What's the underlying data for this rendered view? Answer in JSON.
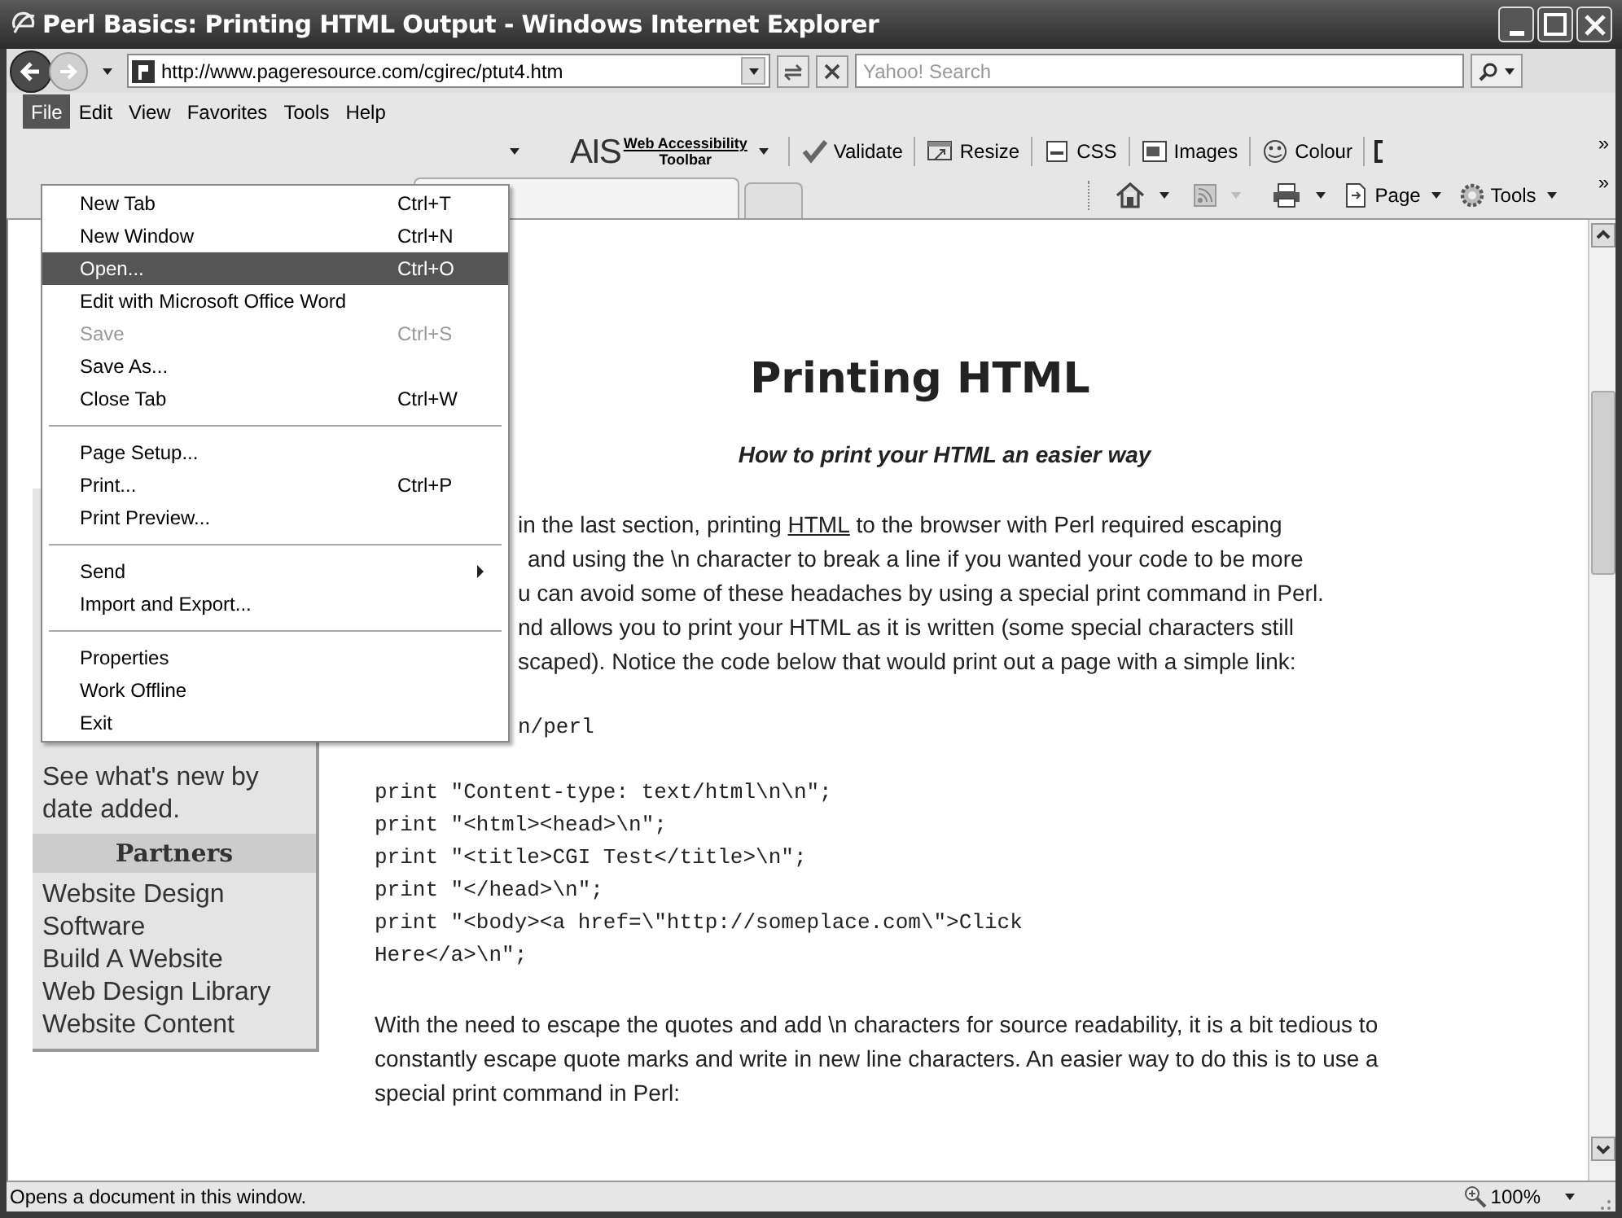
{
  "window": {
    "title": "Perl Basics: Printing HTML Output - Windows Internet Explorer"
  },
  "address_bar": {
    "url": "http://www.pageresource.com/cgirec/ptut4.htm"
  },
  "search": {
    "placeholder": "Yahoo! Search"
  },
  "menu_bar": [
    {
      "label": "File",
      "selected": true
    },
    {
      "label": "Edit",
      "selected": false
    },
    {
      "label": "View",
      "selected": false
    },
    {
      "label": "Favorites",
      "selected": false
    },
    {
      "label": "Tools",
      "selected": false
    },
    {
      "label": "Help",
      "selected": false
    }
  ],
  "toolbar": {
    "ais_logo": "AIS",
    "ais_title": "Web Accessibility",
    "ais_subtitle": "Toolbar",
    "buttons": [
      {
        "label": "Validate"
      },
      {
        "label": "Resize"
      },
      {
        "label": "CSS"
      },
      {
        "label": "Images"
      },
      {
        "label": "Colour"
      }
    ],
    "more": "»"
  },
  "command_bar": {
    "buttons": [
      {
        "label": "Page"
      },
      {
        "label": "Tools"
      }
    ],
    "more": "»"
  },
  "file_menu": [
    {
      "kind": "item",
      "label": "New Tab",
      "shortcut": "Ctrl+T",
      "selected": false,
      "disabled": false
    },
    {
      "kind": "item",
      "label": "New Window",
      "shortcut": "Ctrl+N",
      "selected": false,
      "disabled": false
    },
    {
      "kind": "item",
      "label": "Open...",
      "shortcut": "Ctrl+O",
      "selected": true,
      "disabled": false
    },
    {
      "kind": "item",
      "label": "Edit with Microsoft Office Word",
      "selected": false,
      "disabled": false
    },
    {
      "kind": "item",
      "label": "Save",
      "shortcut": "Ctrl+S",
      "selected": false,
      "disabled": true
    },
    {
      "kind": "item",
      "label": "Save As...",
      "selected": false,
      "disabled": false
    },
    {
      "kind": "item",
      "label": "Close Tab",
      "shortcut": "Ctrl+W",
      "selected": false,
      "disabled": false
    },
    {
      "kind": "separator"
    },
    {
      "kind": "item",
      "label": "Page Setup...",
      "selected": false,
      "disabled": false
    },
    {
      "kind": "item",
      "label": "Print...",
      "shortcut": "Ctrl+P",
      "selected": false,
      "disabled": false
    },
    {
      "kind": "item",
      "label": "Print Preview...",
      "selected": false,
      "disabled": false
    },
    {
      "kind": "separator"
    },
    {
      "kind": "submenu",
      "label": "Send",
      "selected": false,
      "disabled": false
    },
    {
      "kind": "item",
      "label": "Import and Export...",
      "selected": false,
      "disabled": false
    },
    {
      "kind": "separator"
    },
    {
      "kind": "item",
      "label": "Properties",
      "selected": false,
      "disabled": false
    },
    {
      "kind": "item",
      "label": "Work Offline",
      "selected": false,
      "disabled": false
    },
    {
      "kind": "item",
      "label": "Exit",
      "selected": false,
      "disabled": false
    }
  ],
  "sidebar": {
    "lines": [
      "See what's new by",
      "date added."
    ],
    "heading": "Partners",
    "links": [
      "Website Design Software",
      "Build A Website",
      "Web Design Library",
      "Website Content"
    ]
  },
  "article": {
    "heading": "Printing HTML",
    "subtitle": "How to print your HTML an easier way",
    "paragraph_1": [
      {
        "before": "in the last section, printing ",
        "link": "HTML",
        "after": " to the browser with Perl required escaping"
      },
      {
        "before": "and using the \\n character to break a line if you wanted your code to be more"
      },
      {
        "before": "u can avoid some of these headaches by using a special print command in Perl."
      },
      {
        "before": "nd allows you to print your HTML as it is written (some special characters still"
      },
      {
        "before": "scaped). Notice the code below that would print out a page with a simple link:"
      }
    ],
    "code_1_first": "n/perl",
    "code_1": [
      "print \"Content-type: text/html\\n\\n\";",
      "print \"<html><head>\\n\";",
      "print \"<title>CGI Test</title>\\n\";",
      "print \"</head>\\n\";",
      "print \"<body><a href=\\\"http://someplace.com\\\">Click",
      "Here</a>\\n\";"
    ],
    "paragraph_2": "With the need to escape the quotes and add \\n characters for source readability, it is a bit tedious to constantly escape quote marks and write in new line characters. An easier way to do this is to use a special print command in Perl:"
  },
  "status_bar": {
    "text": "Opens a document in this window.",
    "zoom": "100%"
  }
}
